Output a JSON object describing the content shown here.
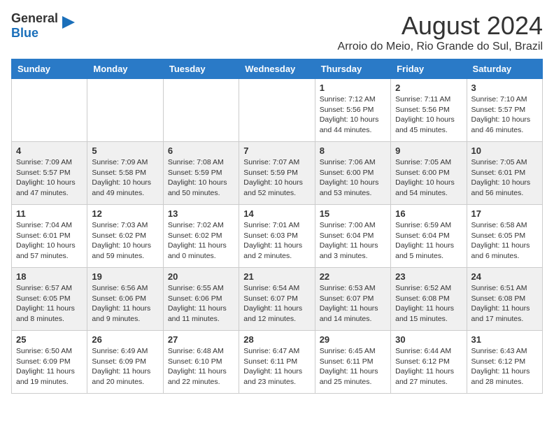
{
  "header": {
    "logo_general": "General",
    "logo_blue": "Blue",
    "month_title": "August 2024",
    "subtitle": "Arroio do Meio, Rio Grande do Sul, Brazil"
  },
  "weekdays": [
    "Sunday",
    "Monday",
    "Tuesday",
    "Wednesday",
    "Thursday",
    "Friday",
    "Saturday"
  ],
  "weeks": [
    [
      {
        "day": "",
        "info": ""
      },
      {
        "day": "",
        "info": ""
      },
      {
        "day": "",
        "info": ""
      },
      {
        "day": "",
        "info": ""
      },
      {
        "day": "1",
        "info": "Sunrise: 7:12 AM\nSunset: 5:56 PM\nDaylight: 10 hours\nand 44 minutes."
      },
      {
        "day": "2",
        "info": "Sunrise: 7:11 AM\nSunset: 5:56 PM\nDaylight: 10 hours\nand 45 minutes."
      },
      {
        "day": "3",
        "info": "Sunrise: 7:10 AM\nSunset: 5:57 PM\nDaylight: 10 hours\nand 46 minutes."
      }
    ],
    [
      {
        "day": "4",
        "info": "Sunrise: 7:09 AM\nSunset: 5:57 PM\nDaylight: 10 hours\nand 47 minutes."
      },
      {
        "day": "5",
        "info": "Sunrise: 7:09 AM\nSunset: 5:58 PM\nDaylight: 10 hours\nand 49 minutes."
      },
      {
        "day": "6",
        "info": "Sunrise: 7:08 AM\nSunset: 5:59 PM\nDaylight: 10 hours\nand 50 minutes."
      },
      {
        "day": "7",
        "info": "Sunrise: 7:07 AM\nSunset: 5:59 PM\nDaylight: 10 hours\nand 52 minutes."
      },
      {
        "day": "8",
        "info": "Sunrise: 7:06 AM\nSunset: 6:00 PM\nDaylight: 10 hours\nand 53 minutes."
      },
      {
        "day": "9",
        "info": "Sunrise: 7:05 AM\nSunset: 6:00 PM\nDaylight: 10 hours\nand 54 minutes."
      },
      {
        "day": "10",
        "info": "Sunrise: 7:05 AM\nSunset: 6:01 PM\nDaylight: 10 hours\nand 56 minutes."
      }
    ],
    [
      {
        "day": "11",
        "info": "Sunrise: 7:04 AM\nSunset: 6:01 PM\nDaylight: 10 hours\nand 57 minutes."
      },
      {
        "day": "12",
        "info": "Sunrise: 7:03 AM\nSunset: 6:02 PM\nDaylight: 10 hours\nand 59 minutes."
      },
      {
        "day": "13",
        "info": "Sunrise: 7:02 AM\nSunset: 6:02 PM\nDaylight: 11 hours\nand 0 minutes."
      },
      {
        "day": "14",
        "info": "Sunrise: 7:01 AM\nSunset: 6:03 PM\nDaylight: 11 hours\nand 2 minutes."
      },
      {
        "day": "15",
        "info": "Sunrise: 7:00 AM\nSunset: 6:04 PM\nDaylight: 11 hours\nand 3 minutes."
      },
      {
        "day": "16",
        "info": "Sunrise: 6:59 AM\nSunset: 6:04 PM\nDaylight: 11 hours\nand 5 minutes."
      },
      {
        "day": "17",
        "info": "Sunrise: 6:58 AM\nSunset: 6:05 PM\nDaylight: 11 hours\nand 6 minutes."
      }
    ],
    [
      {
        "day": "18",
        "info": "Sunrise: 6:57 AM\nSunset: 6:05 PM\nDaylight: 11 hours\nand 8 minutes."
      },
      {
        "day": "19",
        "info": "Sunrise: 6:56 AM\nSunset: 6:06 PM\nDaylight: 11 hours\nand 9 minutes."
      },
      {
        "day": "20",
        "info": "Sunrise: 6:55 AM\nSunset: 6:06 PM\nDaylight: 11 hours\nand 11 minutes."
      },
      {
        "day": "21",
        "info": "Sunrise: 6:54 AM\nSunset: 6:07 PM\nDaylight: 11 hours\nand 12 minutes."
      },
      {
        "day": "22",
        "info": "Sunrise: 6:53 AM\nSunset: 6:07 PM\nDaylight: 11 hours\nand 14 minutes."
      },
      {
        "day": "23",
        "info": "Sunrise: 6:52 AM\nSunset: 6:08 PM\nDaylight: 11 hours\nand 15 minutes."
      },
      {
        "day": "24",
        "info": "Sunrise: 6:51 AM\nSunset: 6:08 PM\nDaylight: 11 hours\nand 17 minutes."
      }
    ],
    [
      {
        "day": "25",
        "info": "Sunrise: 6:50 AM\nSunset: 6:09 PM\nDaylight: 11 hours\nand 19 minutes."
      },
      {
        "day": "26",
        "info": "Sunrise: 6:49 AM\nSunset: 6:09 PM\nDaylight: 11 hours\nand 20 minutes."
      },
      {
        "day": "27",
        "info": "Sunrise: 6:48 AM\nSunset: 6:10 PM\nDaylight: 11 hours\nand 22 minutes."
      },
      {
        "day": "28",
        "info": "Sunrise: 6:47 AM\nSunset: 6:11 PM\nDaylight: 11 hours\nand 23 minutes."
      },
      {
        "day": "29",
        "info": "Sunrise: 6:45 AM\nSunset: 6:11 PM\nDaylight: 11 hours\nand 25 minutes."
      },
      {
        "day": "30",
        "info": "Sunrise: 6:44 AM\nSunset: 6:12 PM\nDaylight: 11 hours\nand 27 minutes."
      },
      {
        "day": "31",
        "info": "Sunrise: 6:43 AM\nSunset: 6:12 PM\nDaylight: 11 hours\nand 28 minutes."
      }
    ]
  ]
}
